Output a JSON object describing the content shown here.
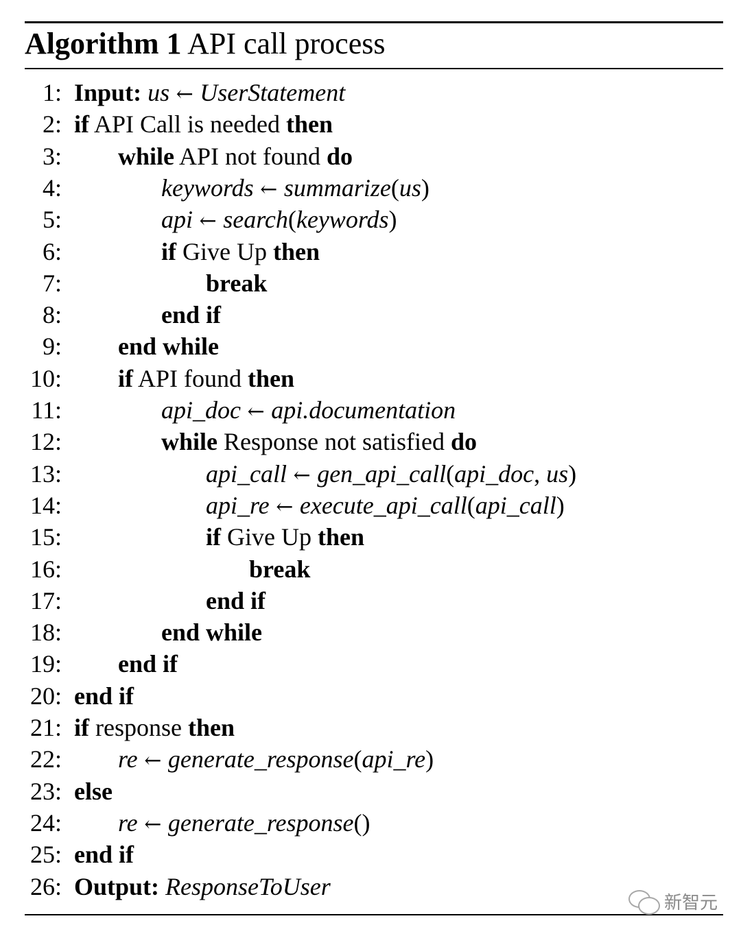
{
  "caption": {
    "label": "Algorithm 1",
    "title": "API call process"
  },
  "lines": [
    {
      "num": "1:",
      "indent": 0,
      "parts": [
        {
          "t": "Input:",
          "s": "kw"
        },
        {
          "t": " "
        },
        {
          "t": "us",
          "s": "m"
        },
        {
          "t": " ← ",
          "s": "sym"
        },
        {
          "t": "UserStatement",
          "s": "m"
        }
      ]
    },
    {
      "num": "2:",
      "indent": 0,
      "parts": [
        {
          "t": "if",
          "s": "kw"
        },
        {
          "t": " API Call is needed "
        },
        {
          "t": "then",
          "s": "kw"
        }
      ]
    },
    {
      "num": "3:",
      "indent": 1,
      "parts": [
        {
          "t": "while",
          "s": "kw"
        },
        {
          "t": " API not found "
        },
        {
          "t": "do",
          "s": "kw"
        }
      ]
    },
    {
      "num": "4:",
      "indent": 2,
      "parts": [
        {
          "t": "keywords",
          "s": "m"
        },
        {
          "t": " ← ",
          "s": "sym"
        },
        {
          "t": "summarize",
          "s": "m"
        },
        {
          "t": "("
        },
        {
          "t": "us",
          "s": "m"
        },
        {
          "t": ")"
        }
      ]
    },
    {
      "num": "5:",
      "indent": 2,
      "parts": [
        {
          "t": "api",
          "s": "m"
        },
        {
          "t": " ← ",
          "s": "sym"
        },
        {
          "t": "search",
          "s": "m"
        },
        {
          "t": "("
        },
        {
          "t": "keywords",
          "s": "m"
        },
        {
          "t": ")"
        }
      ]
    },
    {
      "num": "6:",
      "indent": 2,
      "parts": [
        {
          "t": "if",
          "s": "kw"
        },
        {
          "t": " Give Up "
        },
        {
          "t": "then",
          "s": "kw"
        }
      ]
    },
    {
      "num": "7:",
      "indent": 3,
      "parts": [
        {
          "t": "break",
          "s": "kw"
        }
      ]
    },
    {
      "num": "8:",
      "indent": 2,
      "parts": [
        {
          "t": "end if",
          "s": "kw"
        }
      ]
    },
    {
      "num": "9:",
      "indent": 1,
      "parts": [
        {
          "t": "end while",
          "s": "kw"
        }
      ]
    },
    {
      "num": "10:",
      "indent": 1,
      "parts": [
        {
          "t": "if",
          "s": "kw"
        },
        {
          "t": " API found "
        },
        {
          "t": "then",
          "s": "kw"
        }
      ]
    },
    {
      "num": "11:",
      "indent": 2,
      "parts": [
        {
          "t": "api_doc",
          "s": "m"
        },
        {
          "t": " ← ",
          "s": "sym"
        },
        {
          "t": "api.documentation",
          "s": "m"
        }
      ]
    },
    {
      "num": "12:",
      "indent": 2,
      "parts": [
        {
          "t": "while",
          "s": "kw"
        },
        {
          "t": " Response not satisfied "
        },
        {
          "t": "do",
          "s": "kw"
        }
      ]
    },
    {
      "num": "13:",
      "indent": 3,
      "parts": [
        {
          "t": "api_call",
          "s": "m"
        },
        {
          "t": " ← ",
          "s": "sym"
        },
        {
          "t": "gen_api_call",
          "s": "m"
        },
        {
          "t": "("
        },
        {
          "t": "api_doc",
          "s": "m"
        },
        {
          "t": ", "
        },
        {
          "t": "us",
          "s": "m"
        },
        {
          "t": ")"
        }
      ]
    },
    {
      "num": "14:",
      "indent": 3,
      "parts": [
        {
          "t": "api_re",
          "s": "m"
        },
        {
          "t": " ← ",
          "s": "sym"
        },
        {
          "t": "execute_api_call",
          "s": "m"
        },
        {
          "t": "("
        },
        {
          "t": "api_call",
          "s": "m"
        },
        {
          "t": ")"
        }
      ]
    },
    {
      "num": "15:",
      "indent": 3,
      "parts": [
        {
          "t": "if",
          "s": "kw"
        },
        {
          "t": " Give Up "
        },
        {
          "t": "then",
          "s": "kw"
        }
      ]
    },
    {
      "num": "16:",
      "indent": 4,
      "parts": [
        {
          "t": "break",
          "s": "kw"
        }
      ]
    },
    {
      "num": "17:",
      "indent": 3,
      "parts": [
        {
          "t": "end if",
          "s": "kw"
        }
      ]
    },
    {
      "num": "18:",
      "indent": 2,
      "parts": [
        {
          "t": "end while",
          "s": "kw"
        }
      ]
    },
    {
      "num": "19:",
      "indent": 1,
      "parts": [
        {
          "t": "end if",
          "s": "kw"
        }
      ]
    },
    {
      "num": "20:",
      "indent": 0,
      "parts": [
        {
          "t": "end if",
          "s": "kw"
        }
      ]
    },
    {
      "num": "21:",
      "indent": 0,
      "parts": [
        {
          "t": "if",
          "s": "kw"
        },
        {
          "t": " response "
        },
        {
          "t": "then",
          "s": "kw"
        }
      ]
    },
    {
      "num": "22:",
      "indent": 1,
      "parts": [
        {
          "t": "re",
          "s": "m"
        },
        {
          "t": " ← ",
          "s": "sym"
        },
        {
          "t": "generate_response",
          "s": "m"
        },
        {
          "t": "("
        },
        {
          "t": "api_re",
          "s": "m"
        },
        {
          "t": ")"
        }
      ]
    },
    {
      "num": "23:",
      "indent": 0,
      "parts": [
        {
          "t": "else",
          "s": "kw"
        }
      ]
    },
    {
      "num": "24:",
      "indent": 1,
      "parts": [
        {
          "t": "re",
          "s": "m"
        },
        {
          "t": " ← ",
          "s": "sym"
        },
        {
          "t": "generate_response",
          "s": "m"
        },
        {
          "t": "()"
        }
      ]
    },
    {
      "num": "25:",
      "indent": 0,
      "parts": [
        {
          "t": "end if",
          "s": "kw"
        }
      ]
    },
    {
      "num": "26:",
      "indent": 0,
      "parts": [
        {
          "t": "Output:",
          "s": "kw"
        },
        {
          "t": " "
        },
        {
          "t": "ResponseToUser",
          "s": "m"
        }
      ]
    }
  ],
  "watermark": {
    "text": "新智元",
    "icon": "wechat-icon"
  }
}
